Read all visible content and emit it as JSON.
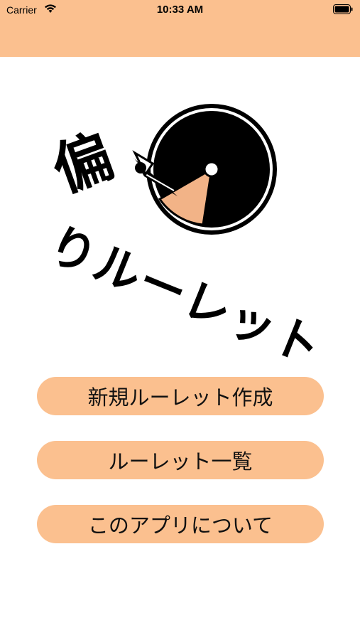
{
  "status_bar": {
    "carrier": "Carrier",
    "time": "10:33 AM",
    "wifi_icon": "wifi-icon",
    "battery_icon": "battery-icon"
  },
  "colors": {
    "accent": "#fbc08f",
    "logo_wedge": "#f2b387",
    "text": "#000000"
  },
  "logo": {
    "char_main": "偏",
    "char_tail": "り",
    "word": "ルーレット"
  },
  "menu": {
    "buttons": [
      {
        "label": "新規ルーレット作成"
      },
      {
        "label": "ルーレット一覧"
      },
      {
        "label": "このアプリについて"
      }
    ]
  }
}
